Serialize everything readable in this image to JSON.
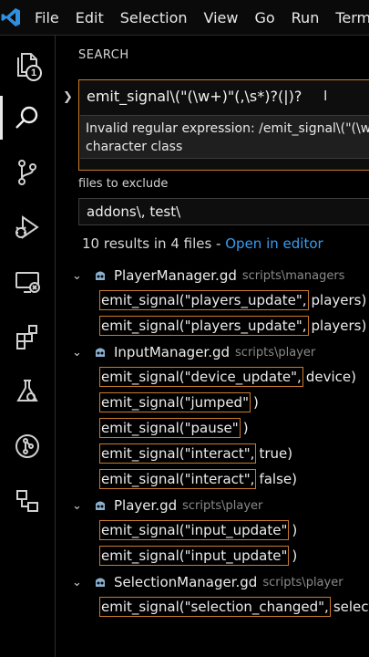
{
  "menubar": {
    "logo": "vscode-logo-icon",
    "items": [
      "File",
      "Edit",
      "Selection",
      "View",
      "Go",
      "Run",
      "Term"
    ]
  },
  "activity": {
    "explorer_badge": "1",
    "icons": [
      "files-icon",
      "search-icon",
      "source-control-icon",
      "run-debug-icon",
      "remote-explorer-icon",
      "extensions-icon",
      "testing-icon",
      "git-graph-icon",
      "godot-scene-icon"
    ]
  },
  "search": {
    "title": "SEARCH",
    "query": "emit_signal\\(\"(\\w+)\"(,\\s*)?(|)?",
    "error_line1": "Invalid regular expression: /emit_signal\\(\"(\\w+)",
    "error_line2": "character class",
    "exclude_label": "files to exclude",
    "exclude_value": "addons\\, test\\",
    "summary": "10 results in 4 files - ",
    "open_in_editor": "Open in editor",
    "accent": "#c97b2c",
    "link_color": "#3a9cf0"
  },
  "results": [
    {
      "file": "PlayerManager.gd",
      "path": "scripts\\managers",
      "matches": [
        {
          "hl": "emit_signal(\"players_update\",",
          "rest": "players)"
        },
        {
          "hl": "emit_signal(\"players_update\",",
          "rest": "players)"
        }
      ]
    },
    {
      "file": "InputManager.gd",
      "path": "scripts\\player",
      "matches": [
        {
          "hl": "emit_signal(\"device_update\",",
          "rest": "device)"
        },
        {
          "hl": "emit_signal(\"jumped\"",
          "rest": ")"
        },
        {
          "hl": "emit_signal(\"pause\"",
          "rest": ")"
        },
        {
          "hl": "emit_signal(\"interact\",",
          "rest": "true)"
        },
        {
          "hl": "emit_signal(\"interact\",",
          "rest": "false)"
        }
      ]
    },
    {
      "file": "Player.gd",
      "path": "scripts\\player",
      "matches": [
        {
          "hl": "emit_signal(\"input_update\"",
          "rest": ")"
        },
        {
          "hl": "emit_signal(\"input_update\"",
          "rest": ")"
        }
      ]
    },
    {
      "file": "SelectionManager.gd",
      "path": "scripts\\player",
      "matches": [
        {
          "hl": "emit_signal(\"selection_changed\",",
          "rest": "selectin"
        }
      ]
    }
  ]
}
